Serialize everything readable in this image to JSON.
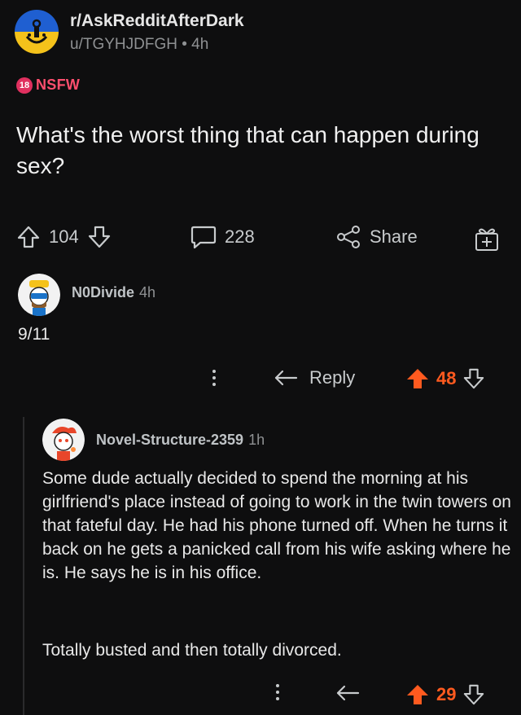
{
  "post": {
    "subreddit": "r/AskRedditAfterDark",
    "meta": "u/TGYHJDFGH • 4h",
    "nsfw_badge": "18",
    "nsfw_label": "NSFW",
    "title": "What's the worst thing that can happen during sex?",
    "upvotes": "104",
    "comments": "228",
    "share_label": "Share"
  },
  "comments": [
    {
      "author": "N0Divide",
      "age": "4h",
      "body": "9/11",
      "reply_label": "Reply",
      "score": "48"
    },
    {
      "author": "Novel-Structure-2359",
      "age": "1h",
      "body_p1": "Some dude actually decided to spend the morning at his girlfriend's place instead of going to work in the twin towers on that fateful day. He had his phone turned off. When he turns it back on he gets a panicked call from his wife asking where he is. He says he is in his office.",
      "body_p2": "Totally busted and then totally divorced.",
      "score": "29"
    }
  ],
  "colors": {
    "background": "#0e0e0f",
    "upvote_active": "#ff5a1f",
    "nsfw": "#ff4f6e",
    "subreddit_icon_top": "#1f5fd1",
    "subreddit_icon_bottom": "#f4c21b"
  },
  "icons": [
    "subreddit-icon",
    "upvote-icon",
    "downvote-icon",
    "comment-icon",
    "share-icon",
    "award-icon",
    "more-icon",
    "reply-icon"
  ]
}
